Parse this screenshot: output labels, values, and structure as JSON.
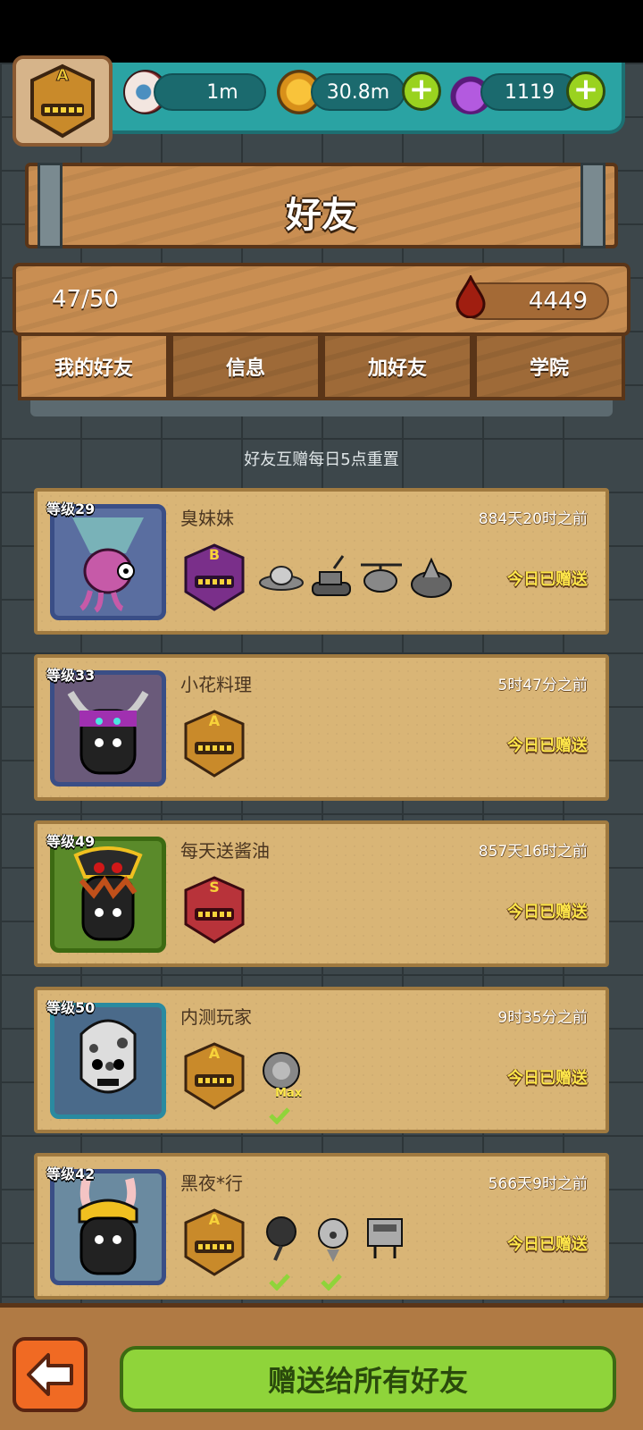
{
  "resources": {
    "eye_value": "1m",
    "coin_value": "30.8m",
    "potion_value": "1119",
    "player_rank": "A"
  },
  "title": "好友",
  "stats": {
    "friend_count": "47/50",
    "blood_value": "4449"
  },
  "tabs": [
    {
      "label": "我的好友",
      "active": true
    },
    {
      "label": "信息",
      "active": false
    },
    {
      "label": "加好友",
      "active": false
    },
    {
      "label": "学院",
      "active": false
    }
  ],
  "reset_note": "好友互赠每日5点重置",
  "friends": [
    {
      "level": "等级29",
      "name": "臭妹妹",
      "time": "884天20时之前",
      "status": "今日已赠送",
      "rank": "B",
      "rank_color": "#7a2f8a"
    },
    {
      "level": "等级33",
      "name": "小花料理",
      "time": "5时47分之前",
      "status": "今日已赠送",
      "rank": "A",
      "rank_color": "#c98a2a"
    },
    {
      "level": "等级49",
      "name": "每天送酱油",
      "time": "857天16时之前",
      "status": "今日已赠送",
      "rank": "S",
      "rank_color": "#b8333a"
    },
    {
      "level": "等级50",
      "name": "内测玩家",
      "time": "9时35分之前",
      "status": "今日已赠送",
      "rank": "A",
      "rank_color": "#c98a2a",
      "max_label": "Max"
    },
    {
      "level": "等级42",
      "name": "黑夜*行",
      "time": "566天9时之前",
      "status": "今日已赠送",
      "rank": "A",
      "rank_color": "#c98a2a"
    }
  ],
  "gift_all_label": "赠送给所有好友"
}
